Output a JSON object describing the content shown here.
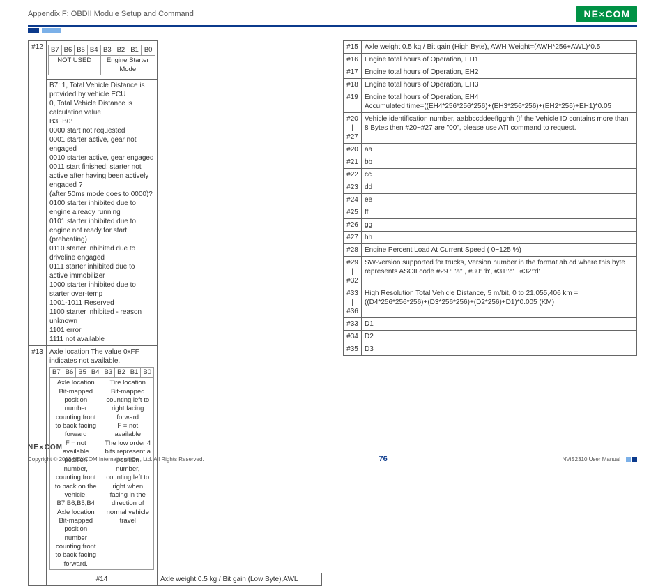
{
  "header": {
    "title": "Appendix F: OBDII Module Setup and Command",
    "logo": "NE✕COM"
  },
  "bits": [
    "B7",
    "B6",
    "B5",
    "B4",
    "B3",
    "B2",
    "B1",
    "B0"
  ],
  "row12_top": {
    "left": "NOT USED",
    "right": "Engine Starter Mode"
  },
  "row12_body": "B7: 1, Total Vehicle Distance is provided by vehicle ECU\n0, Total Vehicle Distance is calculation value\nB3~B0:\n0000 start not requested\n0001 starter active, gear not engaged\n0010 starter active, gear engaged\n0011 start finished; starter not active after having been actively engaged ?\n(after 50ms mode goes to 0000)?\n0100 starter inhibited due to engine already running\n0101 starter inhibited due to engine not ready for start (preheating)\n0110 starter inhibited due to driveline engaged\n0111 starter inhibited due to active immobilizer\n1000 starter inhibited due to starter over-temp\n1001-1011 Reserved\n1100 starter inhibited - reason unknown\n1101 error\n1111 not available",
  "row13_head": "Axle location The value 0xFF indicates not available.",
  "row13_left": "Axle location Bit-mapped position number counting front to back facing forward\nF = not available\nposition number, counting front to back on the vehicle. B7,B6,B5,B4\nAxle location Bit-mapped position number counting front to back facing forward.",
  "row13_right": "Tire location Bit-mapped counting left to right facing forward\nF = not available\nThe low order 4 bits represent a position number, counting left to right when facing in the direction of normal vehicle travel",
  "row14": "Axle weight 0.5 kg / Bit gain (Low Byte),AWL",
  "right_rows": [
    {
      "idx": "#15",
      "txt": "Axle weight 0.5 kg / Bit gain (High Byte), AWH Weight=(AWH*256+AWL)*0.5"
    },
    {
      "idx": "#16",
      "txt": "Engine total hours of Operation, EH1"
    },
    {
      "idx": "#17",
      "txt": "Engine total hours of Operation, EH2"
    },
    {
      "idx": "#18",
      "txt": "Engine total hours of Operation, EH3"
    },
    {
      "idx": "#19",
      "txt": "Engine total hours of Operation, EH4\nAccumulated time=((EH4*256*256*256)+(EH3*256*256)+(EH2*256)+EH1)*0.05"
    },
    {
      "idx": "#20\n|\n#27",
      "txt": "Vehicle identification number, aabbccddeeffgghh (If the Vehicle ID contains more than 8 Bytes then #20~#27 are \"00\", please use ATI command to request."
    },
    {
      "idx": "#20",
      "txt": "aa"
    },
    {
      "idx": "#21",
      "txt": "bb"
    },
    {
      "idx": "#22",
      "txt": "cc"
    },
    {
      "idx": "#23",
      "txt": "dd"
    },
    {
      "idx": "#24",
      "txt": "ee"
    },
    {
      "idx": "#25",
      "txt": "ff"
    },
    {
      "idx": "#26",
      "txt": "gg"
    },
    {
      "idx": "#27",
      "txt": "hh"
    },
    {
      "idx": "#28",
      "txt": "Engine Percent Load At Current Speed ( 0~125 %)"
    },
    {
      "idx": "#29\n|\n#32",
      "txt": "SW-version supported for trucks, Version number in the format ab.cd where this byte represents ASCII code #29 : \"a\" , #30: 'b', #31:'c' , #32:'d'"
    },
    {
      "idx": "#33\n|\n#36",
      "txt": "High Resolution Total Vehicle Distance, 5 m/bit, 0 to 21,055,406 km =((D4*256*256*256)+(D3*256*256)+(D2*256)+D1)*0.005 (KM)"
    },
    {
      "idx": "#33",
      "txt": "D1"
    },
    {
      "idx": "#34",
      "txt": "D2"
    },
    {
      "idx": "#35",
      "txt": "D3"
    }
  ],
  "footer": {
    "logo": "NE✕COM",
    "copyright": "Copyright © 2013 NEXCOM International Co., Ltd. All Rights Reserved.",
    "page": "76",
    "manual": "NViS2310 User Manual"
  }
}
